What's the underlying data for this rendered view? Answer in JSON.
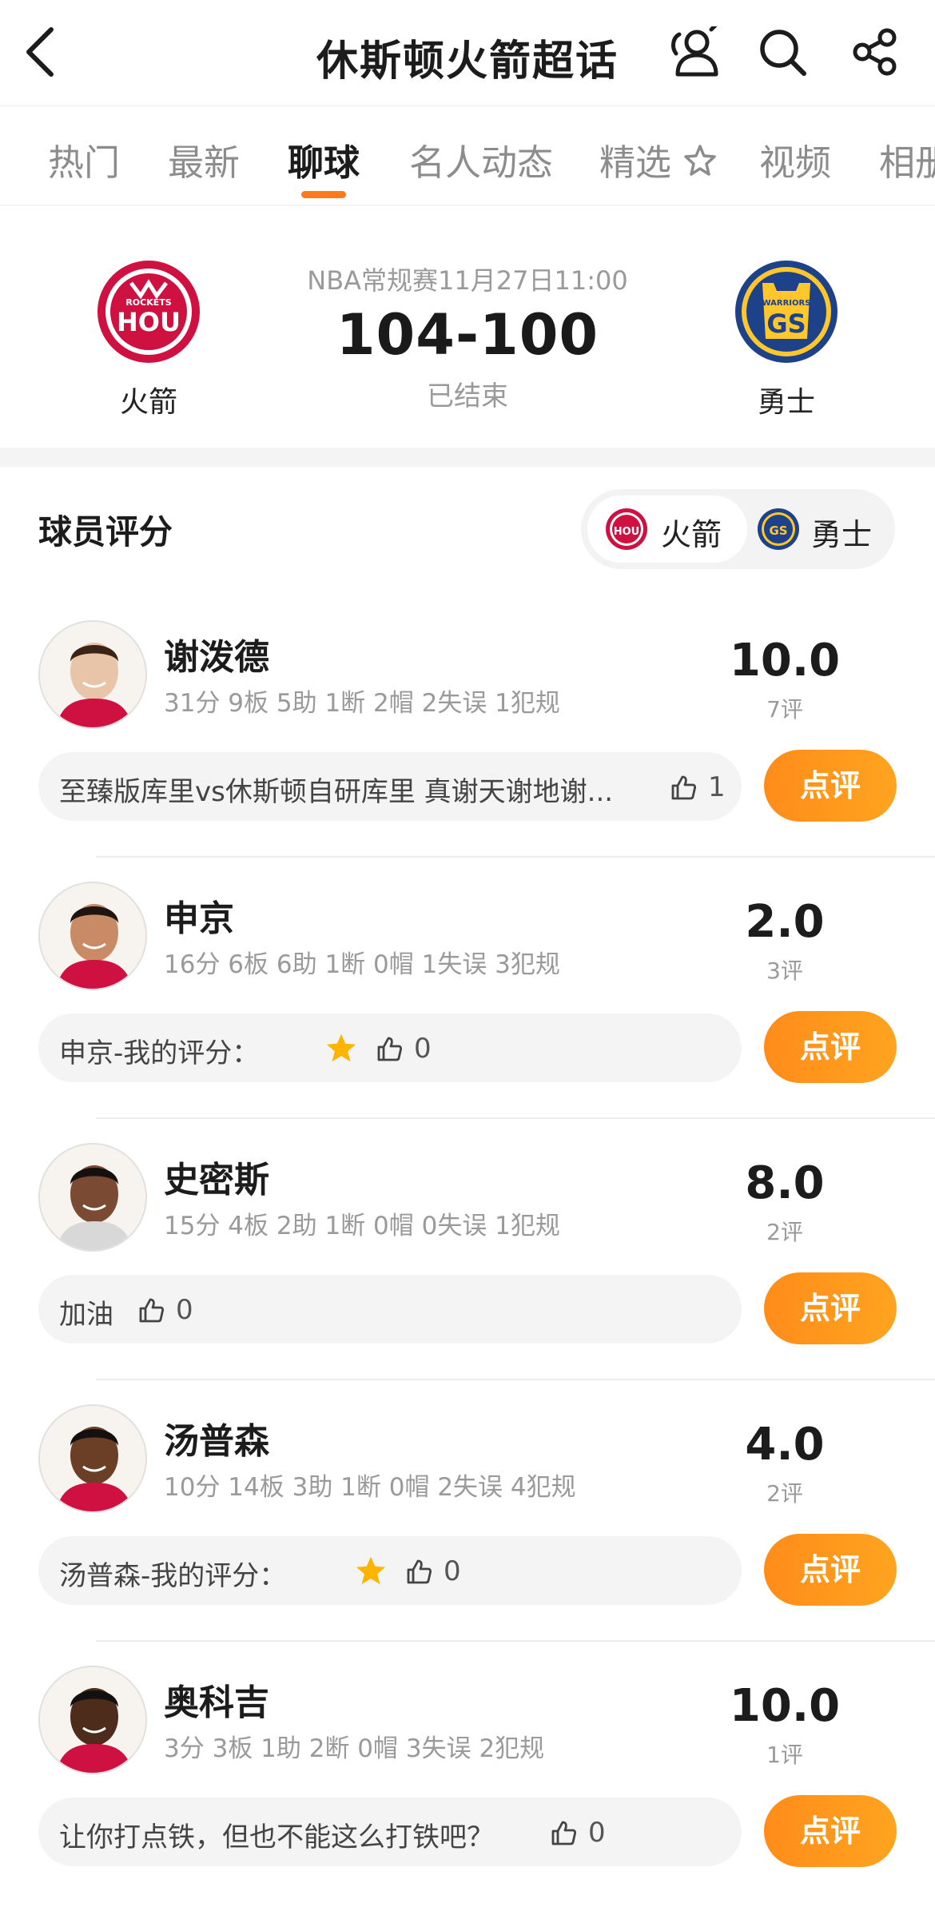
{
  "header": {
    "title": "休斯顿火箭超话"
  },
  "tabs": [
    "热门",
    "最新",
    "聊球",
    "名人动态",
    "精选",
    "视频",
    "相册"
  ],
  "match": {
    "league_time": "NBA常规赛11月27日11:00",
    "score": "104-100",
    "status": "已结束",
    "home": {
      "name": "火箭",
      "logo_text": "HOU",
      "logo_sub": "ROCKETS"
    },
    "away": {
      "name": "勇士",
      "logo_text": "GS",
      "logo_sub": "WARRIORS"
    }
  },
  "ratings_section": {
    "title": "球员评分",
    "switch_home": "火箭",
    "switch_away": "勇士"
  },
  "comment_label": "点评",
  "players": [
    {
      "name": "谢泼德",
      "stats": "31分 9板 5助 1断 2帽 2失误 1犯规",
      "rating": "10.0",
      "count": "7评",
      "comment": "至臻版库里vs休斯顿自研库里 真谢天谢地谢...",
      "has_star": false,
      "likes": "1"
    },
    {
      "name": "申京",
      "stats": "16分 6板 6助 1断 0帽 1失误 3犯规",
      "rating": "2.0",
      "count": "3评",
      "comment": "申京-我的评分：",
      "has_star": true,
      "likes": "0"
    },
    {
      "name": "史密斯",
      "stats": "15分 4板 2助 1断 0帽 0失误 1犯规",
      "rating": "8.0",
      "count": "2评",
      "comment": "加油",
      "has_star": false,
      "likes": "0"
    },
    {
      "name": "汤普森",
      "stats": "10分 14板 3助 1断 0帽 2失误 4犯规",
      "rating": "4.0",
      "count": "2评",
      "comment": "汤普森-我的评分：",
      "has_star": true,
      "likes": "0"
    },
    {
      "name": "奥科吉",
      "stats": "3分 3板 1助 2断 0帽 3失误 2犯规",
      "rating": "10.0",
      "count": "1评",
      "comment": "让你打点铁，但也不能这么打铁吧？",
      "has_star": false,
      "likes": "0"
    }
  ],
  "colors": {
    "accent": "#ff7a1a",
    "button": "#ff9418",
    "rockets_red": "#ce1141",
    "warriors_blue": "#1d428a",
    "warriors_gold": "#ffc72c"
  }
}
